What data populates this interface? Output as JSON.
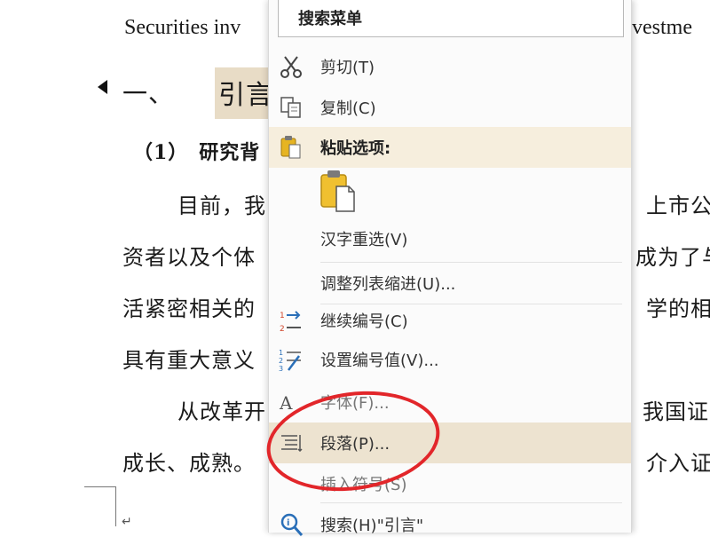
{
  "document": {
    "line1_left": "Securities inv",
    "line1_right": "vestme",
    "heading_num": "一、",
    "heading_text": "引言",
    "subheading": "（1）　研究背",
    "p1_left": "目前，我",
    "p1_right": "上市公",
    "p2_left": "资者以及个体",
    "p2_right": "成为了与",
    "p3_left": "活紧密相关的",
    "p3_right": "学的相",
    "p4_left": "具有重大意义",
    "p5_left": "从改革开",
    "p5_right": "我国证",
    "p6_left": "成长、成熟。",
    "p6_right": "介入证",
    "para_mark": "↵"
  },
  "menu": {
    "search_label": "搜索菜单",
    "items": [
      {
        "label": "剪切(T)",
        "icon": "scissors-icon"
      },
      {
        "label": "复制(C)",
        "icon": "copy-icon"
      },
      {
        "label": "粘贴选项:",
        "icon": "paste-icon"
      },
      {
        "label": "汉字重选(V)",
        "icon": ""
      },
      {
        "label": "调整列表缩进(U)...",
        "icon": ""
      },
      {
        "label": "继续编号(C)",
        "icon": "continue-numbering-icon"
      },
      {
        "label": "设置编号值(V)...",
        "icon": "set-numbering-value-icon"
      },
      {
        "label": "字体(F)...",
        "icon": "font-icon"
      },
      {
        "label": "段落(P)...",
        "icon": "paragraph-icon"
      },
      {
        "label": "插入符号(S)",
        "icon": ""
      },
      {
        "label": "搜索(H)\"引言\"",
        "icon": "search-icon"
      }
    ]
  },
  "colors": {
    "highlight": "#e8dcc6",
    "menu_hover": "#ede3d0",
    "annotation_circle": "#e2262a"
  }
}
